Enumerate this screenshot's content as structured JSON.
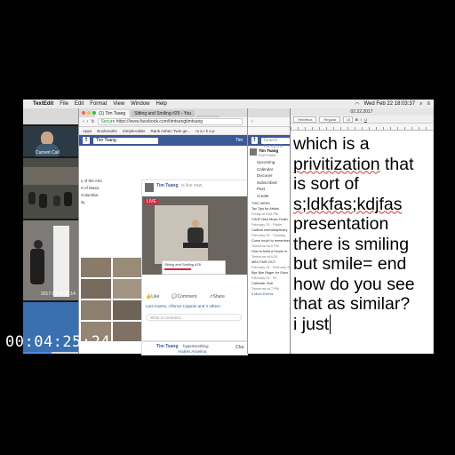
{
  "menubar": {
    "apple_glyph": "",
    "app_name": "TextEdit",
    "menus": [
      "File",
      "Edit",
      "Format",
      "View",
      "Window",
      "Help"
    ],
    "clock": "Wed Feb 22  18:03:37"
  },
  "video_call": {
    "tile_label": "Current Call",
    "date_label": "2017 03 03 20:14"
  },
  "browser_left": {
    "tabs": [
      "(1) Tim Tsang",
      "Sitting and Smiling #25 - You",
      ""
    ],
    "url_secure": "Secure",
    "url": "https://www.facebook.com/timtsangtimtsang",
    "bookmarks": [
      "Apps",
      "Bookmarks",
      "SimpleAdder",
      "Rank Ashen Twin ge...",
      "m a r k a p"
    ],
    "fb_search": "Tim Tsang",
    "fb_user": "Tim",
    "side_items": [
      "y of the Arts",
      "rt of Music",
      "Columbia",
      "ity"
    ],
    "live_post": {
      "author": "Tim Tsang",
      "meta": "is live now.",
      "live_badge": "LIVE",
      "video_caption": "Sitting and Smiling #25"
    },
    "actions": [
      "Like",
      "Comment",
      "Share"
    ],
    "likes_text": "Lars Kaerto, Alfonso Cajardo and 3 others",
    "comment_placeholder": "Write a comment...",
    "second_post_author": "Tim Tsang",
    "second_post_meta": "hyperterettling",
    "second_post_name": "Andrés Asselina",
    "chat_label": "Cha"
  },
  "browser_right": {
    "fb_search": "Search Facebook",
    "profile_name": "Tim Tsang",
    "profile_sub": "Edit Profile",
    "side_items": [
      "Upcoming",
      "Calendar",
      "Discover",
      "Subscribed",
      "Past",
      "Create"
    ],
    "events_header": "THIS WEEK",
    "events": [
      {
        "title": "Tax Tips for Artists",
        "when": "Friday at 6:00 PM"
      },
      {
        "title": "CSUF New Music Festiv",
        "when": "February 25 · Fiddle"
      },
      {
        "title": "Californ Interdisciplinary",
        "when": "February 25 · Tuesday"
      },
      {
        "title": "Come touch to remember",
        "when": "Tomorrow at 6 PM"
      },
      {
        "title": "How to build a House m",
        "when": "Tomorrow at 6:30"
      },
      {
        "title": "MAX FAIR 2017",
        "when": "February 24 · February 25"
      },
      {
        "title": "Bye Bye Rager for Guns",
        "when": "February 24 · Fri"
      },
      {
        "title": "Calendar Club",
        "when": "Tomorrow at 7 PM"
      }
    ],
    "more_events": "6 More Events"
  },
  "textedit": {
    "title": "02.22.2017",
    "toolbar": [
      "Helvetica",
      "Regular",
      "18",
      "B",
      "I",
      "U"
    ],
    "body": "which is a\nprivitization that\nis sort of\ns;ldkfas;kdjfas\npresentation\nthere is smiling\nbut smile= end\nhow do you see\nthat as similar?\ni just"
  },
  "timecode": "00:04:25;24",
  "colors": {
    "facebook_blue": "#3b5998",
    "menu_bar": "#ececec",
    "spell_underline": "#dd3333",
    "progress": "#4a90e2"
  }
}
